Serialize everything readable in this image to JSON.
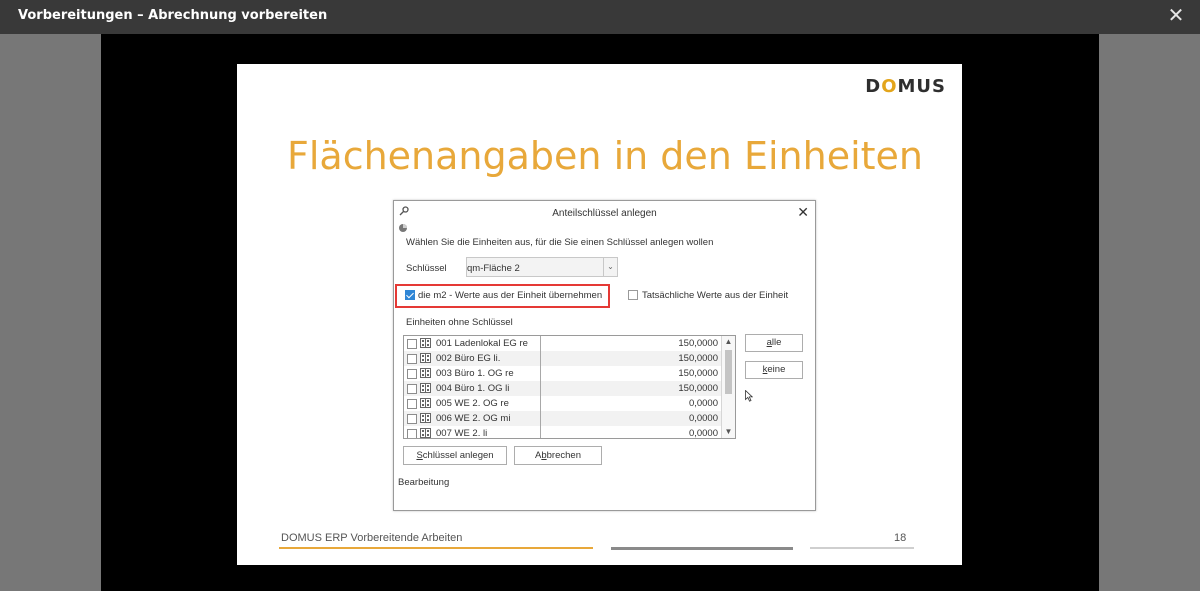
{
  "window": {
    "title": "Vorbereitungen – Abrechnung vorbereiten",
    "close_icon": "✕"
  },
  "slide": {
    "logo": {
      "before": "D",
      "accent": "O",
      "after": "MUS"
    },
    "title": "Flächenangaben in den Einheiten",
    "footer_text": "DOMUS ERP Vorbereitende Arbeiten",
    "page_number": "18",
    "colors": {
      "accent": "#e8a83a",
      "highlight": "#e53935",
      "checkbox": "#2f86d6"
    }
  },
  "dialog": {
    "title": "Anteilschlüssel anlegen",
    "close_icon": "✕",
    "instruction": "Wählen Sie die Einheiten aus, für die Sie einen Schlüssel anlegen wollen",
    "key_label": "Schlüssel",
    "key_value": "qm-Fläche 2",
    "dropdown_arrow": "⌄",
    "checkbox_m2_label": "die m2 - Werte aus der Einheit übernehmen",
    "checkbox_m2_checked": true,
    "checkbox_actual_label": "Tatsächliche Werte aus der Einheit",
    "checkbox_actual_checked": false,
    "list_label": "Einheiten ohne Schlüssel",
    "units": [
      {
        "name": "001 Ladenlokal EG re",
        "value": "150,0000"
      },
      {
        "name": "002 Büro EG li.",
        "value": "150,0000"
      },
      {
        "name": "003 Büro 1. OG re",
        "value": "150,0000"
      },
      {
        "name": "004 Büro 1. OG li",
        "value": "150,0000"
      },
      {
        "name": "005 WE 2. OG re",
        "value": "0,0000"
      },
      {
        "name": "006 WE 2. OG mi",
        "value": "0,0000"
      },
      {
        "name": "007 WE 2. li",
        "value": "0,0000"
      }
    ],
    "scroll_up": "▲",
    "scroll_down": "▼",
    "btn_all_key": "a",
    "btn_all_rest": "lle",
    "btn_none_key": "k",
    "btn_none_rest": "eine",
    "btn_create_key": "S",
    "btn_create_rest": "chlüssel anlegen",
    "btn_cancel_pre": "A",
    "btn_cancel_key": "b",
    "btn_cancel_rest": "brechen",
    "status_label": "Bearbeitung"
  }
}
